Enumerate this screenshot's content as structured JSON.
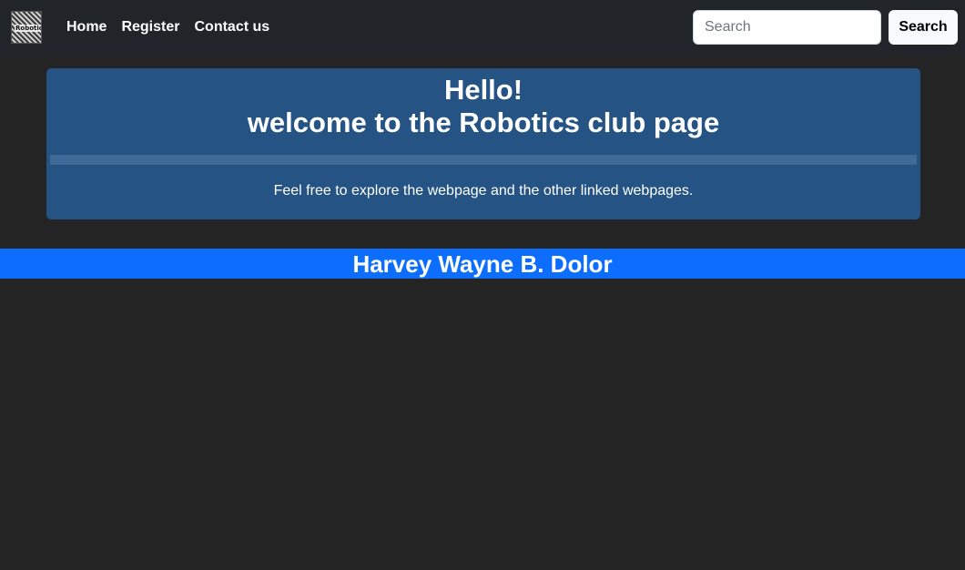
{
  "navbar": {
    "logo_alt": "Robotics",
    "links": [
      "Home",
      "Register",
      "Contact us"
    ],
    "search": {
      "placeholder": "Search",
      "value": "",
      "button_label": "Search"
    },
    "background": "#212529"
  },
  "hero": {
    "title": "Hello!",
    "subtitle": "welcome to the Robotics club page",
    "text": "Feel free to explore the webpage and the other linked webpages.",
    "background": "#245384"
  },
  "banner": {
    "name": "Harvey Wayne B. Dolor",
    "background": "#0d6efd"
  },
  "page_background": "#242424"
}
